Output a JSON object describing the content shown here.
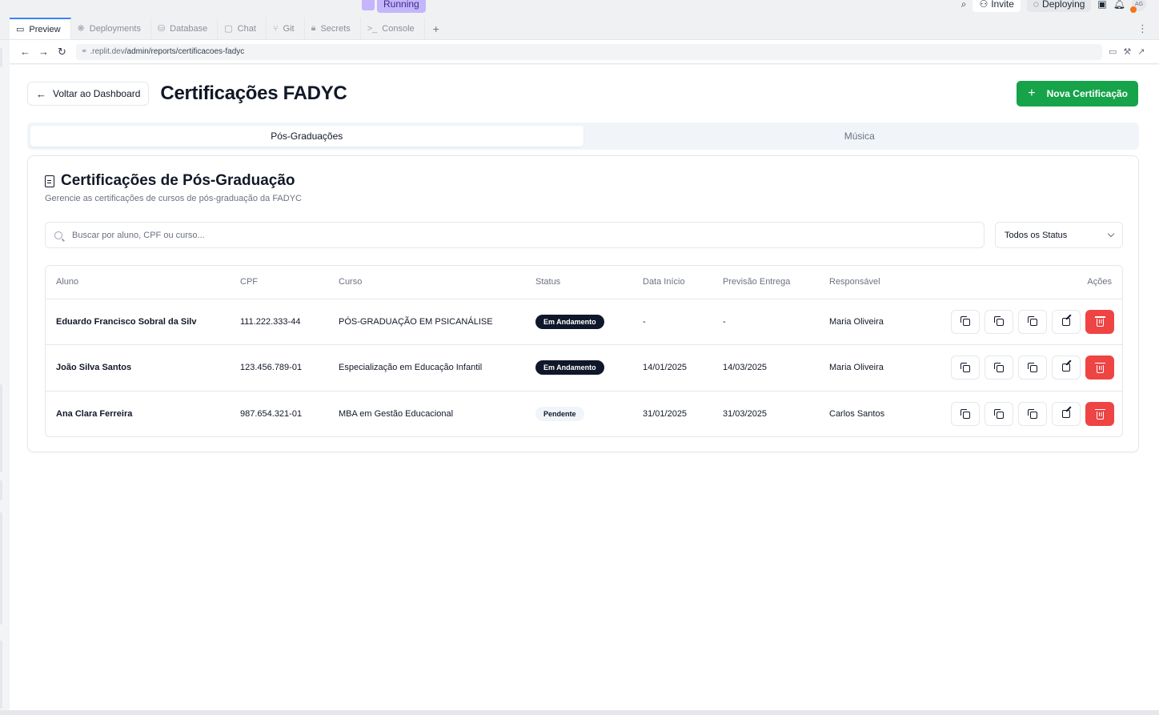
{
  "ide": {
    "running_label": "Running",
    "invite_label": "Invite",
    "deploying_label": "Deploying",
    "avatar_initials": "AG",
    "tabs": [
      {
        "label": "Preview",
        "icon": "monitor-icon",
        "active": true
      },
      {
        "label": "Deployments",
        "icon": "deploy-icon",
        "active": false
      },
      {
        "label": "Database",
        "icon": "database-icon",
        "active": false
      },
      {
        "label": "Chat",
        "icon": "chat-icon",
        "active": false
      },
      {
        "label": "Git",
        "icon": "git-icon",
        "active": false
      },
      {
        "label": "Secrets",
        "icon": "lock-icon",
        "active": false
      },
      {
        "label": "Console",
        "icon": "terminal-icon",
        "active": false
      }
    ],
    "url_host": ".replit.dev",
    "url_path": "/admin/reports/certificacoes-fadyc"
  },
  "page": {
    "back_label": "Voltar ao Dashboard",
    "title": "Certificações FADYC",
    "new_button_label": "Nova Certificação",
    "tabs": [
      {
        "label": "Pós-Graduações",
        "active": true
      },
      {
        "label": "Música",
        "active": false
      }
    ],
    "card_title": "Certificações de Pós-Graduação",
    "card_subtitle": "Gerencie as certificações de cursos de pós-graduação da FADYC",
    "search_placeholder": "Buscar por aluno, CPF ou curso...",
    "status_filter": "Todos os Status",
    "columns": [
      "Aluno",
      "CPF",
      "Curso",
      "Status",
      "Data Início",
      "Previsão Entrega",
      "Responsável",
      "Ações"
    ],
    "rows": [
      {
        "aluno": "Eduardo Francisco Sobral da Silv",
        "cpf": "111.222.333-44",
        "curso": "PÓS-GRADUAÇÃO EM PSICANÁLISE",
        "status": "Em Andamento",
        "data_inicio": "-",
        "previsao": "-",
        "responsavel": "Maria Oliveira"
      },
      {
        "aluno": "João Silva Santos",
        "cpf": "123.456.789-01",
        "curso": "Especialização em Educação Infantil",
        "status": "Em Andamento",
        "data_inicio": "14/01/2025",
        "previsao": "14/03/2025",
        "responsavel": "Maria Oliveira"
      },
      {
        "aluno": "Ana Clara Ferreira",
        "cpf": "987.654.321-01",
        "curso": "MBA em Gestão Educacional",
        "status": "Pendente",
        "data_inicio": "31/01/2025",
        "previsao": "31/03/2025",
        "responsavel": "Carlos Santos"
      }
    ]
  },
  "colors": {
    "primary_green": "#16a34a",
    "danger_red": "#ef4444",
    "badge_dark": "#0f172a",
    "badge_light": "#f1f5f9"
  }
}
